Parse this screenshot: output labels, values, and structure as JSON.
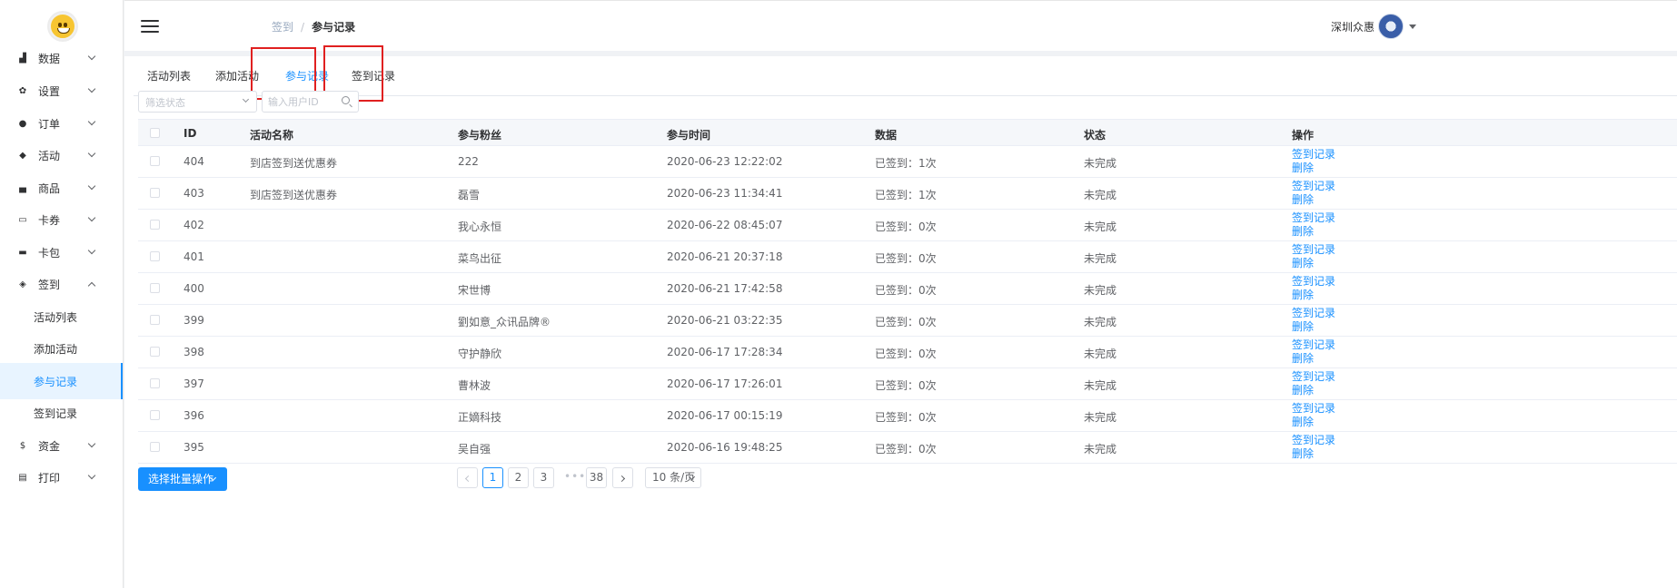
{
  "sidebar": {
    "menu": [
      {
        "label": "数据",
        "icon": "bar-chart-icon"
      },
      {
        "label": "设置",
        "icon": "gear-icon"
      },
      {
        "label": "订单",
        "icon": "info-icon"
      },
      {
        "label": "活动",
        "icon": "tag-icon"
      },
      {
        "label": "商品",
        "icon": "basket-icon"
      },
      {
        "label": "卡券",
        "icon": "card-icon"
      },
      {
        "label": "卡包",
        "icon": "wallet-icon"
      },
      {
        "label": "签到",
        "icon": "box-icon"
      }
    ],
    "submenu": [
      "活动列表",
      "添加活动",
      "参与记录",
      "签到记录"
    ],
    "menu_bottom": [
      {
        "label": "资金",
        "icon": "dollar-icon"
      },
      {
        "label": "打印",
        "icon": "printer-icon"
      }
    ]
  },
  "header": {
    "breadcrumb": [
      "签到",
      "参与记录"
    ],
    "breadcrumb_sep": "/",
    "user_name": "深圳众惠"
  },
  "tabs": [
    "活动列表",
    "添加活动",
    "参与记录",
    "签到记录"
  ],
  "filters": {
    "status_placeholder": "筛选状态",
    "search_placeholder": "输入用户ID"
  },
  "table": {
    "columns": [
      "ID",
      "活动名称",
      "参与粉丝",
      "参与时间",
      "数据",
      "状态",
      "操作"
    ],
    "rows": [
      {
        "id": "404",
        "activity": "到店签到送优惠券",
        "fan": "222",
        "time": "2020-06-23 12:22:02",
        "data": "已签到：1次",
        "status": "未完成"
      },
      {
        "id": "403",
        "activity": "到店签到送优惠券",
        "fan": "磊雪",
        "time": "2020-06-23 11:34:41",
        "data": "已签到：1次",
        "status": "未完成"
      },
      {
        "id": "402",
        "activity": "",
        "fan": "我心永恒",
        "time": "2020-06-22 08:45:07",
        "data": "已签到：0次",
        "status": "未完成"
      },
      {
        "id": "401",
        "activity": "",
        "fan": "菜鸟出征",
        "time": "2020-06-21 20:37:18",
        "data": "已签到：0次",
        "status": "未完成"
      },
      {
        "id": "400",
        "activity": "",
        "fan": "宋世博",
        "time": "2020-06-21 17:42:58",
        "data": "已签到：0次",
        "status": "未完成"
      },
      {
        "id": "399",
        "activity": "",
        "fan": "劉如意_众讯品牌®",
        "time": "2020-06-21 03:22:35",
        "data": "已签到：0次",
        "status": "未完成"
      },
      {
        "id": "398",
        "activity": "",
        "fan": "守护静欣",
        "time": "2020-06-17 17:28:34",
        "data": "已签到：0次",
        "status": "未完成"
      },
      {
        "id": "397",
        "activity": "",
        "fan": "曹林波",
        "time": "2020-06-17 17:26:01",
        "data": "已签到：0次",
        "status": "未完成"
      },
      {
        "id": "396",
        "activity": "",
        "fan": "正嫡科技",
        "time": "2020-06-17 00:15:19",
        "data": "已签到：0次",
        "status": "未完成"
      },
      {
        "id": "395",
        "activity": "",
        "fan": "吴自强",
        "time": "2020-06-16 19:48:25",
        "data": "已签到：0次",
        "status": "未完成"
      }
    ],
    "op_signin": "签到记录",
    "op_delete": "删除"
  },
  "footer": {
    "batch_label": "选择批量操作",
    "pages": [
      "1",
      "2",
      "3"
    ],
    "more": "•••",
    "last_page": "38",
    "page_size": "10 条/页"
  },
  "colors": {
    "accent": "#1890ff",
    "highlight": "#e02020"
  }
}
